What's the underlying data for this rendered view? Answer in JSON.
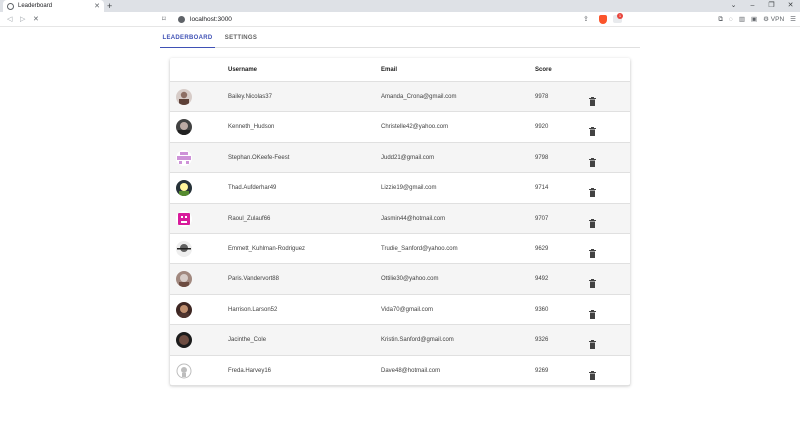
{
  "browser": {
    "tab_title": "Leaderboard",
    "tab_close": "✕",
    "new_tab": "+",
    "url": "localhost:3000",
    "vpn_label": "VPN",
    "rewards_badge": "1"
  },
  "app": {
    "tabs": [
      {
        "label": "LEADERBOARD",
        "active": true
      },
      {
        "label": "SETTINGS",
        "active": false
      }
    ],
    "accent_color": "#3f51b5"
  },
  "table": {
    "headers": {
      "username": "Username",
      "email": "Email",
      "score": "Score"
    },
    "rows": [
      {
        "avatar": "photo-avatar",
        "username": "Bailey.Nicolas37",
        "email": "Amanda_Crona@gmail.com",
        "score": "9978"
      },
      {
        "avatar": "photo-avatar",
        "username": "Kenneth_Hudson",
        "email": "Christelle42@yahoo.com",
        "score": "9920"
      },
      {
        "avatar": "identicon-avatar",
        "username": "Stephan.OKeefe-Feest",
        "email": "Judd21@gmail.com",
        "score": "9798"
      },
      {
        "avatar": "photo-avatar",
        "username": "Thad.Aufderhar49",
        "email": "Lizzie19@gmail.com",
        "score": "9714"
      },
      {
        "avatar": "identicon-avatar",
        "username": "Raoul_Zulauf66",
        "email": "Jasmin44@hotmail.com",
        "score": "9707"
      },
      {
        "avatar": "photo-avatar",
        "username": "Emmett_Kuhlman-Rodriguez",
        "email": "Trudie_Sanford@yahoo.com",
        "score": "9629"
      },
      {
        "avatar": "photo-avatar",
        "username": "Paris.Vandervort88",
        "email": "Ottilie30@yahoo.com",
        "score": "9492"
      },
      {
        "avatar": "photo-avatar",
        "username": "Harrison.Larson52",
        "email": "Vida70@gmail.com",
        "score": "9360"
      },
      {
        "avatar": "photo-avatar",
        "username": "Jacinthe_Cole",
        "email": "Kristin.Sanford@gmail.com",
        "score": "9326"
      },
      {
        "avatar": "github-avatar",
        "username": "Freda.Harvey16",
        "email": "Dave48@hotmail.com",
        "score": "9269"
      }
    ]
  }
}
